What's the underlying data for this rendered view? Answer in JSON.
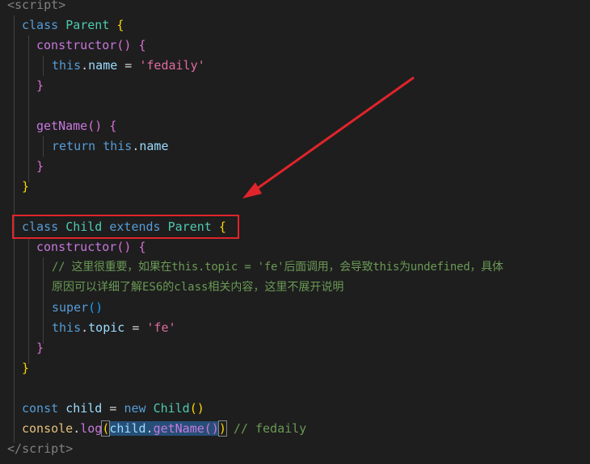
{
  "code": {
    "l1_open": "<",
    "l1_tag": "script",
    "l1_close": ">",
    "l2_kw": "class",
    "l2_name": "Parent",
    "l2_brace": "{",
    "l3_ctor": "constructor",
    "l3_parens": "()",
    "l3_brace": "{",
    "l4_this": "this",
    "l4_dot": ".",
    "l4_prop": "name",
    "l4_eq": " = ",
    "l4_str": "'fedaily'",
    "l5_brace": "}",
    "l7_fn": "getName",
    "l7_parens": "()",
    "l7_brace": "{",
    "l8_ret": "return",
    "l8_this": "this",
    "l8_dot": ".",
    "l8_prop": "name",
    "l9_brace": "}",
    "l10_brace": "}",
    "l12_kw": "class",
    "l12_name": "Child",
    "l12_ext": "extends",
    "l12_parent": "Parent",
    "l12_brace": "{",
    "l13_ctor": "constructor",
    "l13_parens": "()",
    "l13_brace": "{",
    "l14_comment": "// 这里很重要，如果在this.topic = 'fe'后面调用，会导致this为undefined，具体",
    "l15_comment": "原因可以详细了解ES6的class相关内容，这里不展开说明",
    "l16_super": "super",
    "l16_parens": "()",
    "l17_this": "this",
    "l17_dot": ".",
    "l17_prop": "topic",
    "l17_eq": " = ",
    "l17_str": "'fe'",
    "l18_brace": "}",
    "l19_brace": "}",
    "l21_const": "const",
    "l21_var": "child",
    "l21_eq": " = ",
    "l21_new": "new",
    "l21_cls": "Child",
    "l21_parens": "()",
    "l22_console": "console",
    "l22_dot": ".",
    "l22_log": "log",
    "l22_open": "(",
    "l22_child": "child",
    "l22_dot2": ".",
    "l22_fn": "getName",
    "l22_parens": "()",
    "l22_close": ")",
    "l22_comment": " // fedaily",
    "l23_open": "</",
    "l23_tag": "script",
    "l23_close": ">"
  },
  "colors": {
    "background": "#1e1e1e",
    "annotation_red": "#e0242b"
  }
}
